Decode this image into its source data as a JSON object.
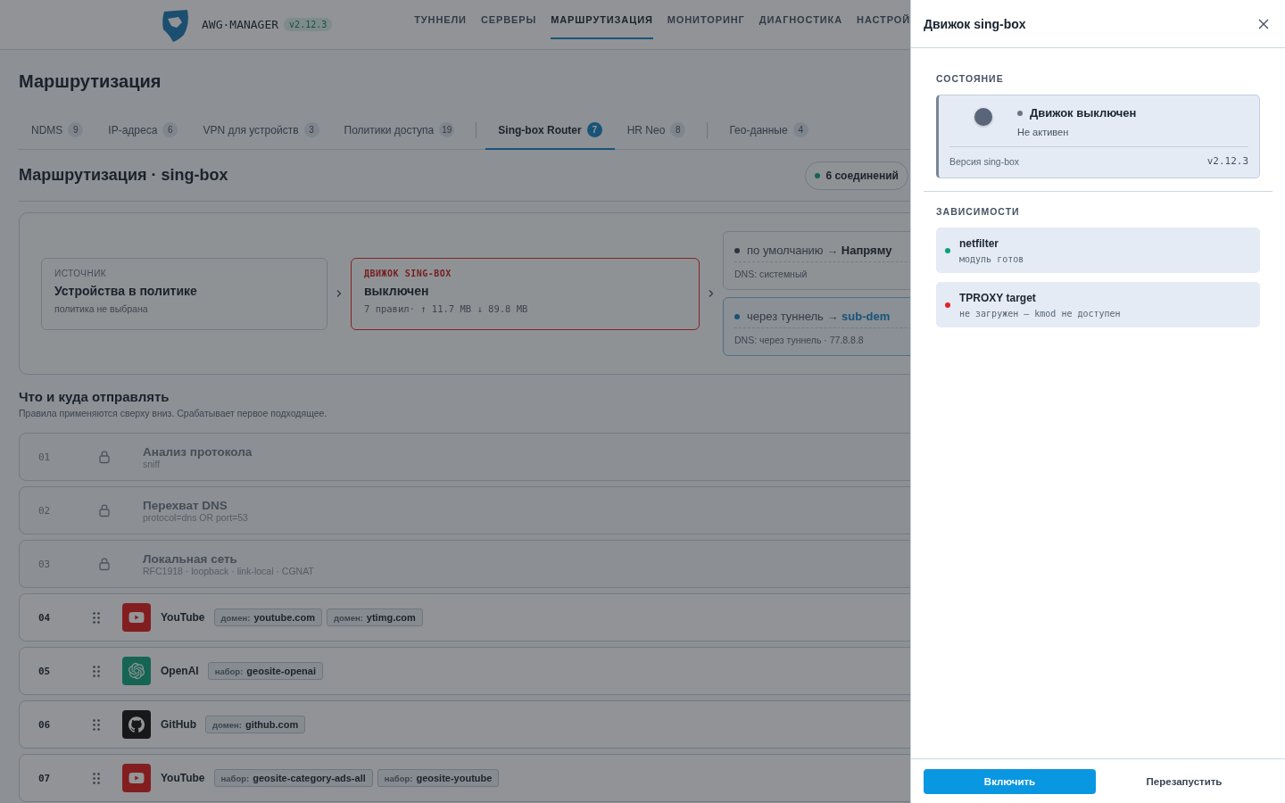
{
  "header": {
    "brand": "AWG·MANAGER",
    "version": "v2.12.3",
    "nav": [
      {
        "label": "ТУННЕЛИ",
        "selected": false
      },
      {
        "label": "СЕРВЕРЫ",
        "selected": false
      },
      {
        "label": "МАРШРУТИЗАЦИЯ",
        "selected": true
      },
      {
        "label": "МОНИТОРИНГ",
        "selected": false
      },
      {
        "label": "ДИАГНОСТИКА",
        "selected": false
      },
      {
        "label": "НАСТРОЙ",
        "selected": false
      }
    ]
  },
  "page_title": "Маршрутизация",
  "tabs": [
    {
      "label": "NDMS",
      "count": "9",
      "selected": false,
      "divider_after": false
    },
    {
      "label": "IP-адреса",
      "count": "6",
      "selected": false,
      "divider_after": false
    },
    {
      "label": "VPN для устройств",
      "count": "3",
      "selected": false,
      "divider_after": false
    },
    {
      "label": "Политики доступа",
      "count": "19",
      "selected": false,
      "divider_after": true
    },
    {
      "label": "Sing-box Router",
      "count": "7",
      "selected": true,
      "divider_after": false
    },
    {
      "label": "HR Neo",
      "count": "8",
      "selected": false,
      "divider_after": true
    },
    {
      "label": "Гео-данные",
      "count": "4",
      "selected": false,
      "divider_after": false
    }
  ],
  "section": {
    "title": "Маршрутизация · sing-box",
    "connections": "6 соединений"
  },
  "flow": {
    "source": {
      "label": "ИСТОЧНИК",
      "title": "Устройства в политике",
      "note": "политика не выбрана"
    },
    "engine": {
      "label": "ДВИЖОК SING-BOX",
      "title": "выключен",
      "stats": "7 правил· ↑ 11.7 MB ↓ 89.8 MB",
      "running": false
    },
    "outputs": [
      {
        "kind": "direct",
        "prefix": "по умолчанию →",
        "target": "Напряму",
        "dns": "DNS: системный"
      },
      {
        "kind": "tunnel",
        "prefix": "через туннель →",
        "target": "sub-dem",
        "dns": "DNS: через туннель · 77.8.8.8"
      }
    ]
  },
  "rules": {
    "title": "Что и куда отправлять",
    "subtitle": "Правила применяются сверху вниз. Срабатывает первое подходящее.",
    "items": [
      {
        "kind": "system",
        "number": "01",
        "title": "Анализ протокола",
        "detail": "sniff"
      },
      {
        "kind": "system",
        "number": "02",
        "title": "Перехват DNS",
        "detail": "protocol=dns OR port=53"
      },
      {
        "kind": "system",
        "number": "03",
        "title": "Локальная сеть",
        "detail": "RFC1918 · loopback · link-local · CGNAT"
      },
      {
        "kind": "youtube",
        "number": "04",
        "name": "YouTube",
        "tags": [
          {
            "type": "домен:",
            "value": "youtube.com"
          },
          {
            "type": "домен:",
            "value": "ytimg.com"
          }
        ]
      },
      {
        "kind": "openai",
        "number": "05",
        "name": "OpenAI",
        "tags": [
          {
            "type": "набор:",
            "value": "geosite-openai"
          }
        ]
      },
      {
        "kind": "github",
        "number": "06",
        "name": "GitHub",
        "tags": [
          {
            "type": "домен:",
            "value": "github.com"
          }
        ]
      },
      {
        "kind": "youtube",
        "number": "07",
        "name": "YouTube",
        "tags": [
          {
            "type": "набор:",
            "value": "geosite-category-ads-all"
          },
          {
            "type": "набор:",
            "value": "geosite-youtube"
          }
        ]
      }
    ]
  },
  "drawer": {
    "title": "Движок sing-box",
    "state_heading": "СОСТОЯНИЕ",
    "status": {
      "running": false,
      "title": "Движок выключен",
      "subtitle": "Не активен",
      "version_label": "Версия sing-box",
      "version": "v2.12.3"
    },
    "deps_heading": "ЗАВИСИМОСТИ",
    "deps": [
      {
        "name": "netfilter",
        "detail": "модуль готов",
        "color": "#0e9f7e"
      },
      {
        "name": "TPROXY target",
        "detail": "не загружен — kmod не доступен",
        "color": "#dc2626"
      }
    ],
    "primary_button": "Включить",
    "secondary_button": "Перезапустить"
  }
}
